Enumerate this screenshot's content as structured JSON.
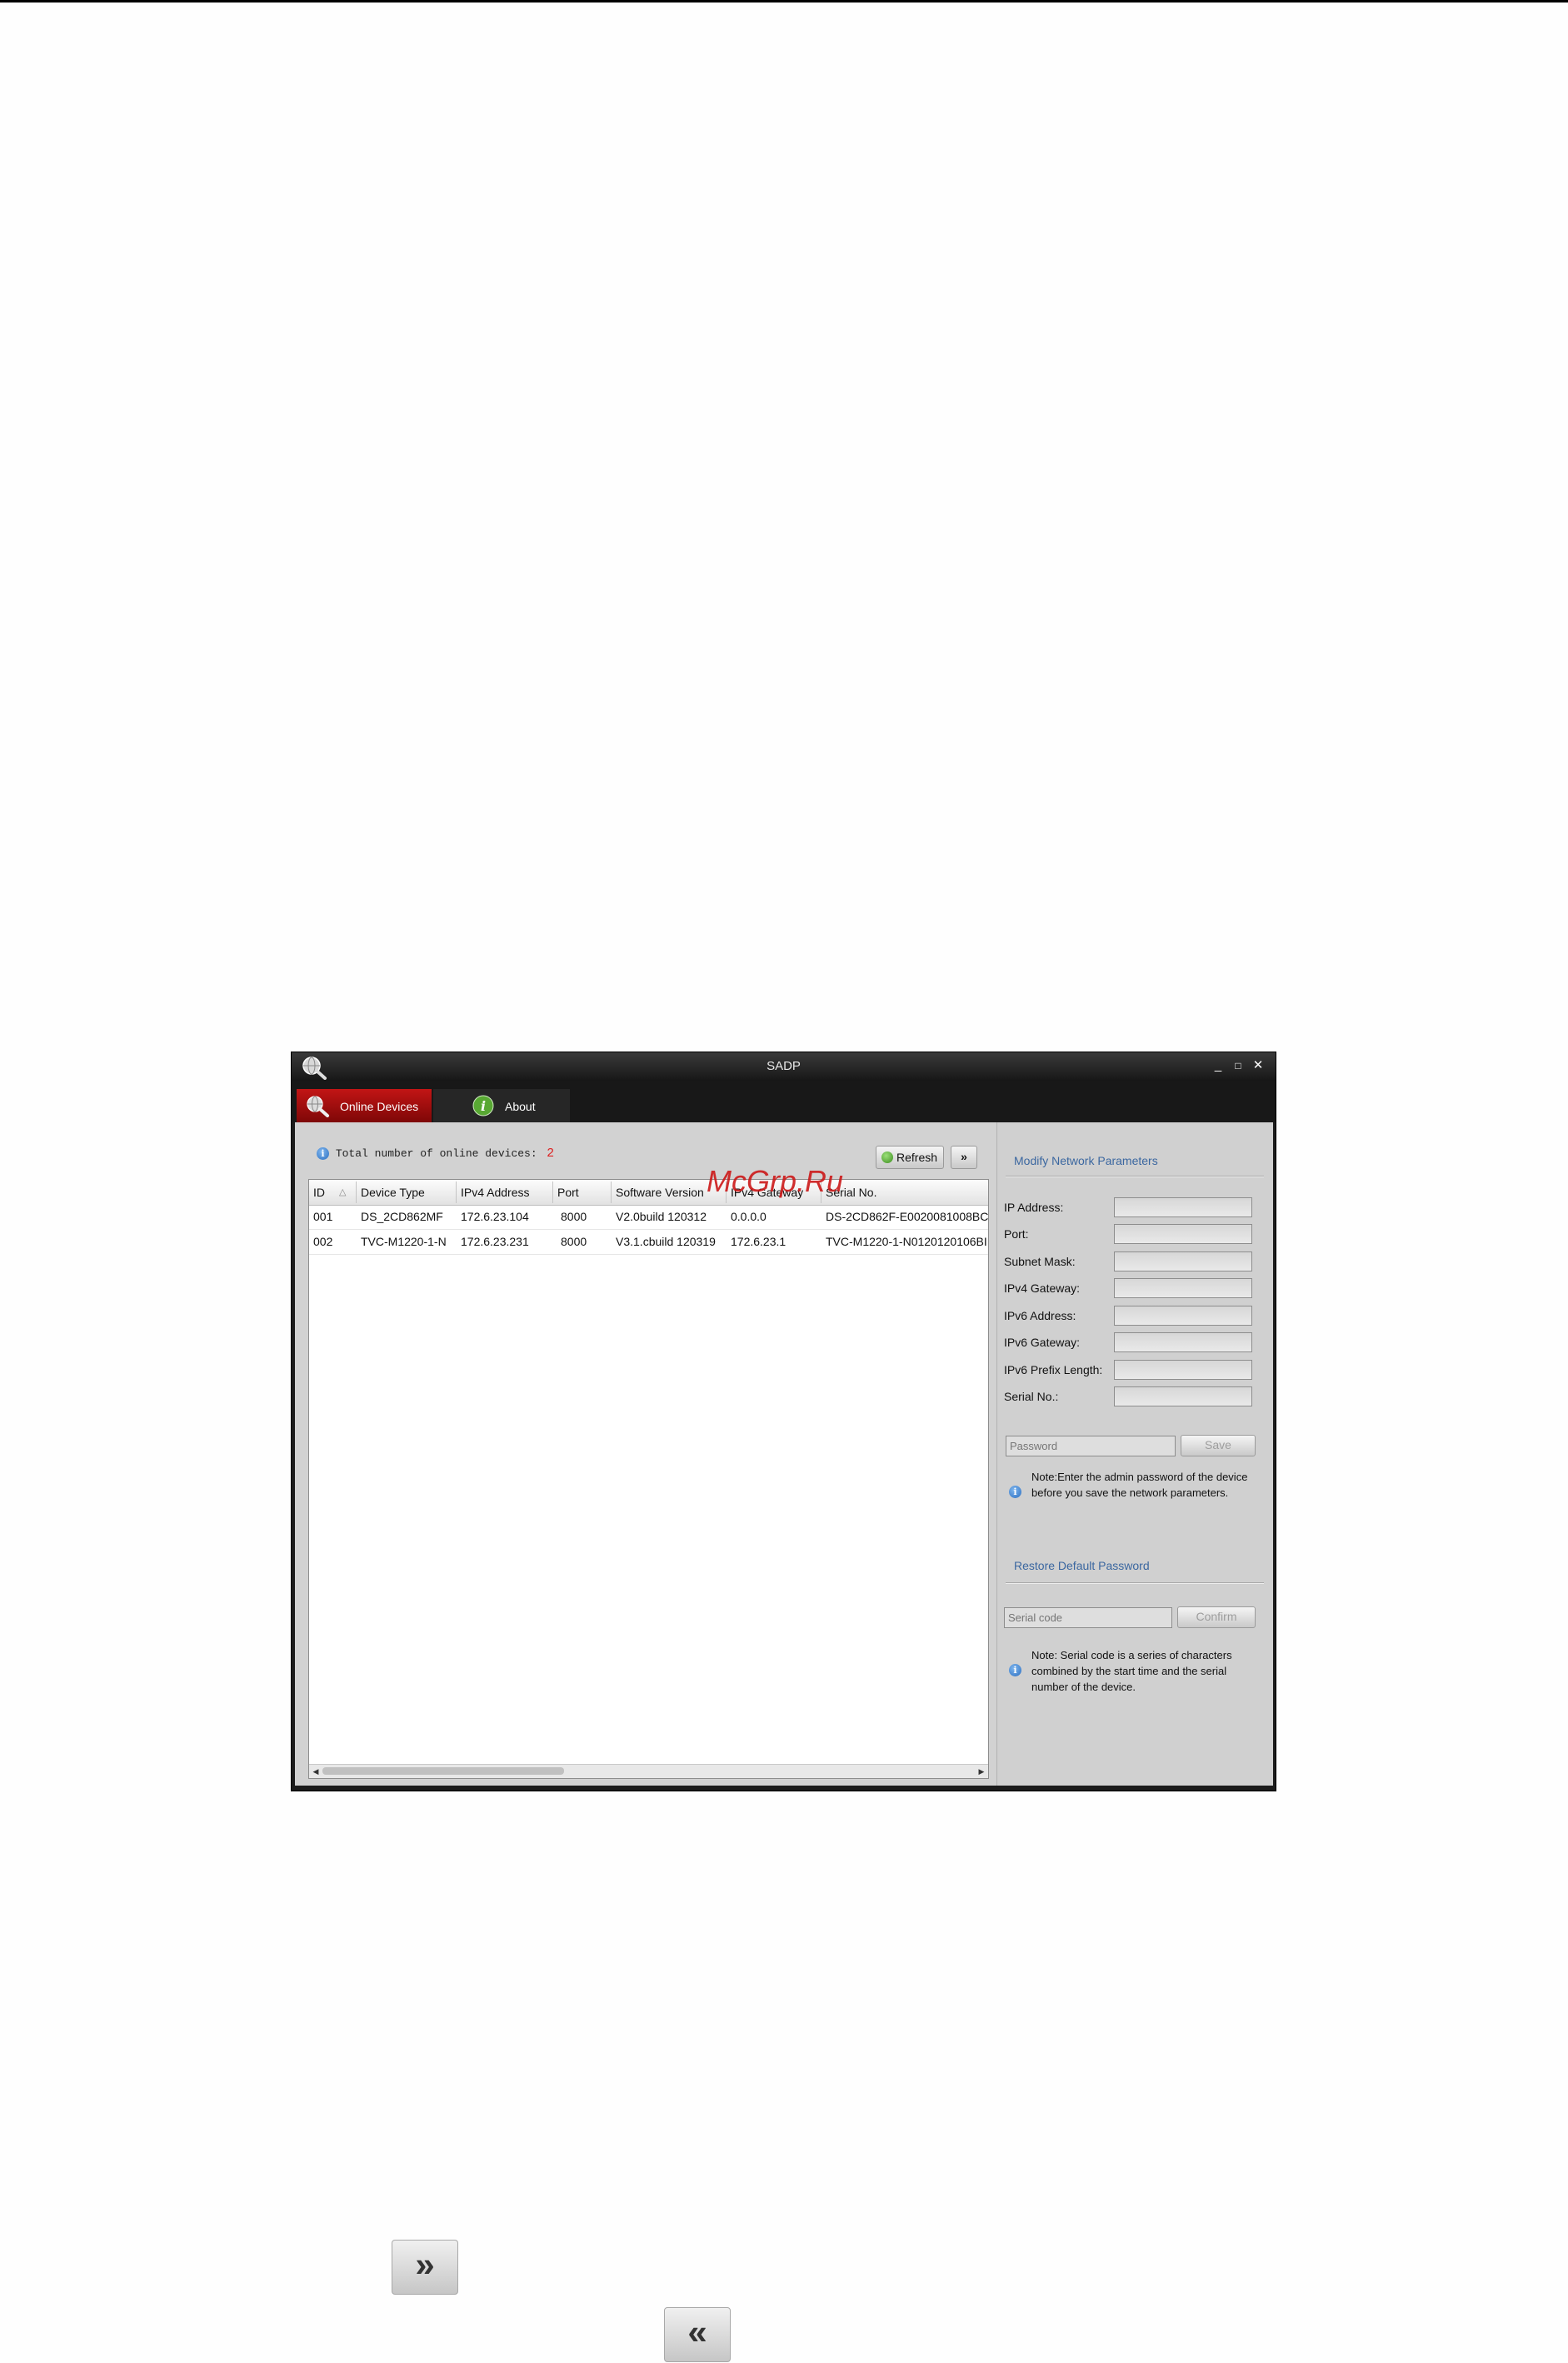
{
  "window": {
    "title": "SADP",
    "controls": [
      "_",
      "□",
      "✕"
    ]
  },
  "tabs": [
    {
      "label": "Online Devices",
      "icon": "search-globe-icon",
      "active": true
    },
    {
      "label": "About",
      "icon": "info-green-icon",
      "active": false
    }
  ],
  "device_count": {
    "label": "Total number of online devices:",
    "value": "2"
  },
  "toolbar": {
    "refresh_label": "Refresh",
    "expand_label": "»"
  },
  "table": {
    "columns": [
      "ID",
      "Device Type",
      "IPv4 Address",
      "Port",
      "Software Version",
      "IPv4 Gateway",
      "Serial No."
    ],
    "rows": [
      [
        "001",
        "DS_2CD862MF",
        "172.6.23.104",
        "8000",
        "V2.0build 120312",
        "0.0.0.0",
        "DS-2CD862F-E0020081008BC"
      ],
      [
        "002",
        "TVC-M1220-1-N",
        "172.6.23.231",
        "8000",
        "V3.1.cbuild 120319",
        "172.6.23.1",
        "TVC-M1220-1-N0120120106BI"
      ]
    ]
  },
  "modify_panel": {
    "title": "Modify Network Parameters",
    "fields": [
      {
        "label": "IP Address:",
        "value": ""
      },
      {
        "label": "Port:",
        "value": ""
      },
      {
        "label": "Subnet Mask:",
        "value": ""
      },
      {
        "label": "IPv4 Gateway:",
        "value": ""
      },
      {
        "label": "IPv6 Address:",
        "value": ""
      },
      {
        "label": "IPv6 Gateway:",
        "value": ""
      },
      {
        "label": "IPv6 Prefix Length:",
        "value": ""
      },
      {
        "label": "Serial No.:",
        "value": ""
      }
    ],
    "password_placeholder": "Password",
    "save_label": "Save",
    "note": "Note:Enter the admin password of the device before you save the network parameters."
  },
  "restore_panel": {
    "title": "Restore Default Password",
    "serial_placeholder": "Serial code",
    "confirm_label": "Confirm",
    "note": "Note: Serial code is a series of characters combined by the start time and the serial number of the device."
  },
  "watermark": "McGrp.Ru",
  "bottom_buttons": {
    "expand": "»",
    "collapse": "«"
  },
  "colors": {
    "active_tab": "#b01010",
    "section_title": "#3b67a0",
    "count_value": "#dd2222",
    "watermark": "#cc1818"
  }
}
